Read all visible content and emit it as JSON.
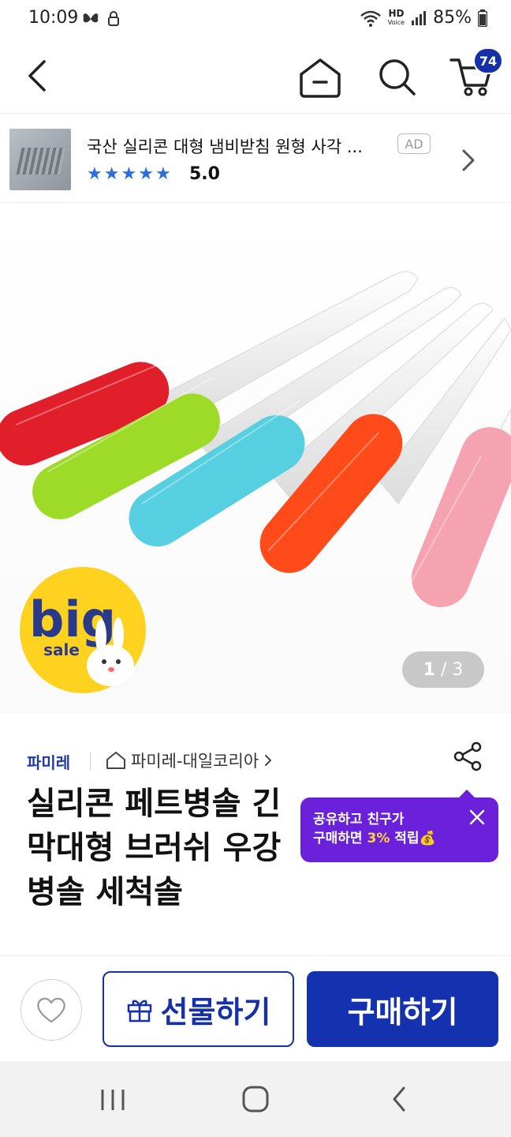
{
  "status_bar": {
    "time": "10:09",
    "network": "HD",
    "network_sub": "Voice",
    "battery": "85%"
  },
  "header": {
    "cart_count": "74"
  },
  "ad_banner": {
    "title": "국산 실리콘 대형 냄비받침 원형 사각 ...",
    "tag": "AD",
    "rating": "5.0",
    "stars": 5
  },
  "hero": {
    "sale_badge_big": "big",
    "sale_badge_small": "sale",
    "pager_current": "1",
    "pager_sep": " / ",
    "pager_total": "3"
  },
  "product": {
    "brand": "파미레",
    "shop": "파미레-대일코리아",
    "title_line1": "실리콘 페트병솔 긴",
    "title_line2": "막대형 브러쉬 우강",
    "title_line3": "병솔 세척솔"
  },
  "tooltip": {
    "line1": "공유하고 친구가",
    "line2_a": "구매하면 ",
    "line2_pct": "3%",
    "line2_b": " 적립",
    "emoji": "💰"
  },
  "actions": {
    "gift_label": "선물하기",
    "buy_label": "구매하기"
  },
  "colors": {
    "brand_blue": "#1431b0",
    "tooltip_purple": "#6b21d9",
    "star_blue": "#2a6fdb"
  }
}
